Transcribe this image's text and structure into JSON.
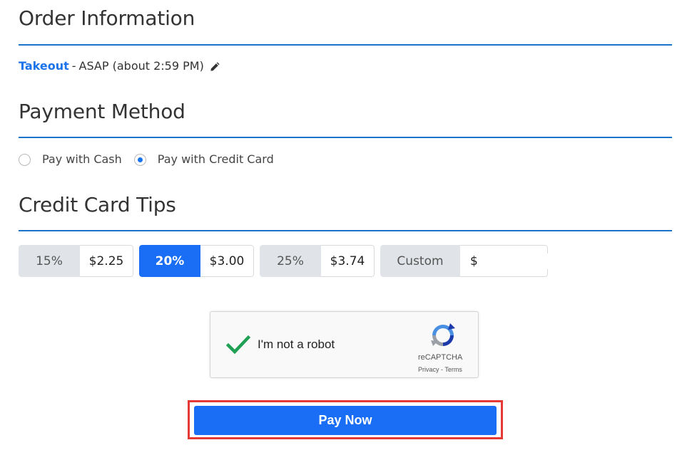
{
  "order_info": {
    "title": "Order Information",
    "order_type": "Takeout",
    "separator": "-",
    "timing": "ASAP (about 2:59 PM)",
    "edit_icon": "pencil-icon"
  },
  "payment_method": {
    "title": "Payment Method",
    "options": [
      {
        "label": "Pay with Cash",
        "selected": false
      },
      {
        "label": "Pay with Credit Card",
        "selected": true
      }
    ]
  },
  "tips": {
    "title": "Credit Card Tips",
    "options": [
      {
        "percent": "15%",
        "amount": "$2.25",
        "selected": false
      },
      {
        "percent": "20%",
        "amount": "$3.00",
        "selected": true
      },
      {
        "percent": "25%",
        "amount": "$3.74",
        "selected": false
      }
    ],
    "custom": {
      "label": "Custom",
      "currency": "$",
      "value": ""
    }
  },
  "captcha": {
    "label": "I'm not a robot",
    "checked": true,
    "brand": "reCAPTCHA",
    "privacy": "Privacy",
    "link_sep": "-",
    "terms": "Terms"
  },
  "pay_button": {
    "label": "Pay Now"
  },
  "colors": {
    "accent": "#1a6ef5",
    "link": "#1a73e8",
    "rule": "#1a73c8",
    "highlight": "#e53935",
    "check": "#1fa055"
  }
}
